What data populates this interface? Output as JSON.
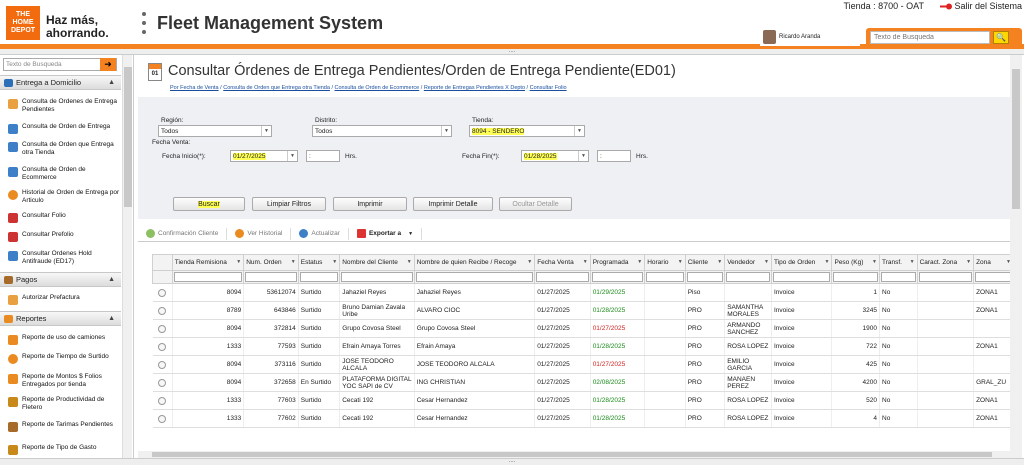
{
  "header": {
    "logo_text": "THE HOME DEPOT",
    "slogan": "Haz más,\nahorrando.",
    "app_title": "Fleet Management System",
    "store_info": "Tienda : 8700 - OAT",
    "logout_label": "Salir del Sistema",
    "user_name": "Ricardo Aranda",
    "search_placeholder": "Texto de Busqueda"
  },
  "sidebar": {
    "search_placeholder": "Texto de Busqueda",
    "sections": [
      {
        "label": "Entrega a Domicilio"
      },
      {
        "label": "Pagos"
      },
      {
        "label": "Reportes"
      }
    ],
    "entrega_items": [
      "Consulta de Ordenes de Entrega Pendientes",
      "Consulta de Orden de Entrega",
      "Consulta de Orden que Entrega otra Tienda",
      "Consulta de Orden de Ecommerce",
      "Historial de Orden de Entrega por Articulo",
      "Consultar Folio",
      "Consultar Prefolio",
      "Consultar Ordenes Hold Antifraude (ED17)"
    ],
    "pagos_items": [
      "Autorizar Prefactura"
    ],
    "reportes_items": [
      "Reporte de uso de camiones",
      "Reporte de Tiempo de Surtido",
      "Reporte de Montos $ Folios Entregados por tienda",
      "Reporte de Productividad de Fletero",
      "Reporte de Tarimas Pendientes",
      "Reporte de Tipo de Gasto"
    ]
  },
  "page": {
    "icon_label": "01",
    "title": "Consultar Órdenes de Entrega Pendientes/Orden de Entrega Pendiente(ED01)",
    "breadcrumbs": [
      "Por Fecha de Venta",
      "Consulta de Orden que Entrega otra Tienda",
      "Consulta de Orden de Ecommerce",
      "Reporte de Entregas Pendientes X Depto",
      "Consultar Folio"
    ]
  },
  "filters": {
    "region_label": "Región:",
    "region_value": "Todos",
    "distrito_label": "Distrito:",
    "distrito_value": "Todos",
    "tienda_label": "Tienda:",
    "tienda_value": "8094 - SENDERO",
    "fecha_venta_label": "Fecha Venta:",
    "fecha_inicio_label": "Fecha Inicio(*):",
    "fecha_inicio_value": "01/27/2025",
    "fecha_fin_label": "Fecha Fin(*):",
    "fecha_fin_value": "01/28/2025",
    "time_sep": ":",
    "hrs_label": "Hrs."
  },
  "buttons": {
    "buscar": "Buscar",
    "limpiar": "Limpiar Filtros",
    "imprimir": "Imprimir",
    "imprimir_detalle": "Imprimir Detalle",
    "ocultar_detalle": "Ocultar Detalle"
  },
  "toolbar": {
    "confirmacion": "Confirmación Cliente",
    "historial": "Ver Historial",
    "actualizar": "Actualizar",
    "exportar": "Exportar a"
  },
  "table": {
    "columns": [
      "Tienda Remisiona",
      "Num. Orden",
      "Estatus",
      "Nombre del Cliente",
      "Nombre de quien Recibe / Recoge",
      "Fecha Venta",
      "Programada",
      "Horario",
      "Cliente",
      "Vendedor",
      "Tipo de Orden",
      "Peso (Kg)",
      "Transf.",
      "Caract. Zona",
      "Zona"
    ],
    "rows": [
      [
        "8094",
        "53612074",
        "Surtido",
        "Jahaziel Reyes",
        "Jahaziel Reyes",
        "01/27/2025",
        "01/29/2025",
        "",
        "Piso",
        "",
        "Invoice",
        "1",
        "No",
        "",
        "ZONA1"
      ],
      [
        "8789",
        "643846",
        "Surtido",
        "Bruno Damian Zavala Uribe",
        "ALVARO CIOC",
        "01/27/2025",
        "01/28/2025",
        "",
        "PRO",
        "SAMANTHA MORALES",
        "Invoice",
        "3245",
        "No",
        "",
        "ZONA1"
      ],
      [
        "8094",
        "372814",
        "Surtido",
        "Grupo Covosa Steel",
        "Grupo Covosa Steel",
        "01/27/2025",
        "01/27/2025",
        "",
        "PRO",
        "ARMANDO SANCHEZ",
        "Invoice",
        "1900",
        "No",
        "",
        ""
      ],
      [
        "1333",
        "77593",
        "Surtido",
        "Efrain Amaya Torres",
        "Efrain Amaya",
        "01/27/2025",
        "01/28/2025",
        "",
        "PRO",
        "ROSA LOPEZ",
        "Invoice",
        "722",
        "No",
        "",
        "ZONA1"
      ],
      [
        "8094",
        "373116",
        "Surtido",
        "JOSE TEODORO ALCALA",
        "JOSE TEODORO ALCALA",
        "01/27/2025",
        "01/27/2025",
        "",
        "PRO",
        "EMILIO GARCIA",
        "Invoice",
        "425",
        "No",
        "",
        ""
      ],
      [
        "8094",
        "372658",
        "En Surtido",
        "PLATAFORMA DIGITAL YOC SAPI de CV",
        "ING CHRISTIAN",
        "01/27/2025",
        "02/08/2025",
        "",
        "PRO",
        "MANAEN PEREZ",
        "Invoice",
        "4200",
        "No",
        "",
        "GRAL_ZU"
      ],
      [
        "1333",
        "77603",
        "Surtido",
        "Cecati 192",
        "Cesar Hernandez",
        "01/27/2025",
        "01/28/2025",
        "",
        "PRO",
        "ROSA LOPEZ",
        "Invoice",
        "520",
        "No",
        "",
        "ZONA1"
      ],
      [
        "1333",
        "77602",
        "Surtido",
        "Cecati 192",
        "Cesar Hernandez",
        "01/27/2025",
        "01/28/2025",
        "",
        "PRO",
        "ROSA LOPEZ",
        "Invoice",
        "4",
        "No",
        "",
        "ZONA1"
      ]
    ],
    "programada_colors": [
      "green",
      "green",
      "red",
      "green",
      "red",
      "green",
      "green",
      "green"
    ]
  }
}
